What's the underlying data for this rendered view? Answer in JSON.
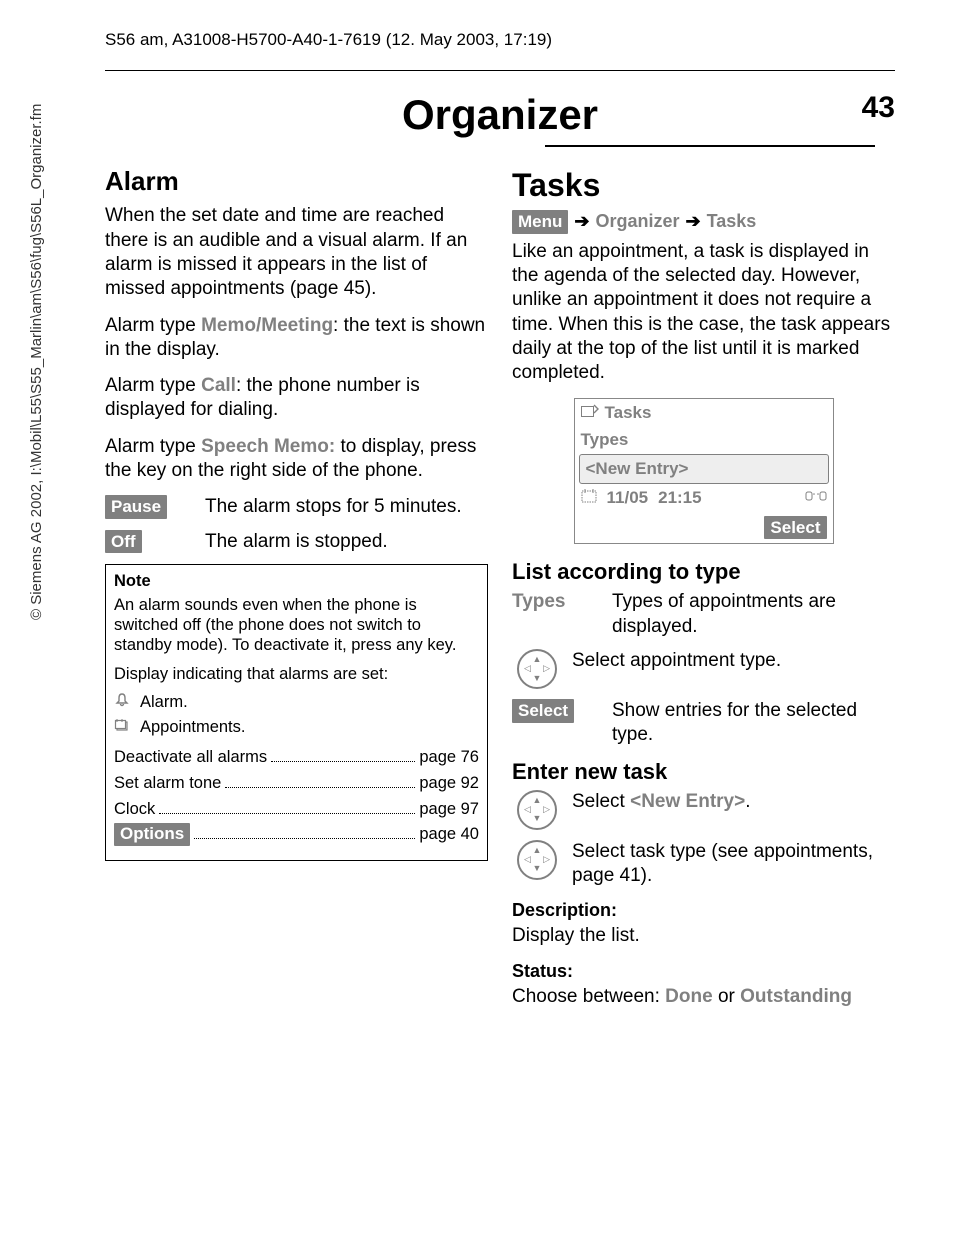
{
  "copyright": "© Siemens AG 2002, I:\\Mobil\\L55\\S55_Marlin\\am\\S56\\fug\\S56L_Organizer.fm",
  "doc_header": "S56 am, A31008-H5700-A40-1-7619 (12. May 2003, 17:19)",
  "chapter_title": "Organizer",
  "page_number": "43",
  "left": {
    "alarm_heading": "Alarm",
    "alarm_para1": "When the set date and time are reached there is an audible and a visual alarm. If an alarm is missed it appears in the list of missed appointments (page 45).",
    "alarm_type_memo_pre": "Alarm type ",
    "alarm_type_memo_label": "Memo/Meeting",
    "alarm_type_memo_post": ": the text is shown in the display.",
    "alarm_type_call_pre": "Alarm type ",
    "alarm_type_call_label": "Call",
    "alarm_type_call_post": ": the phone number is displayed for dialing.",
    "alarm_type_speech_pre": "Alarm type ",
    "alarm_type_speech_label": "Speech Memo:",
    "alarm_type_speech_post": " to display, press the key on the right side of the phone.",
    "pause_btn": "Pause",
    "pause_text": "The alarm stops for 5 minutes.",
    "off_btn": "Off",
    "off_text": "The alarm is stopped.",
    "note_title": "Note",
    "note_p1": "An alarm sounds even when the phone is switched off (the phone does not switch to standby mode). To deactivate it, press any key.",
    "note_p2": "Display indicating that alarms are set:",
    "note_alarm_label": "Alarm.",
    "note_appts_label": "Appointments.",
    "refs": [
      {
        "label": "Deactivate all alarms",
        "page": "page 76"
      },
      {
        "label": "Set alarm tone",
        "page": "page 92"
      },
      {
        "label": "Clock",
        "page": "page 97"
      }
    ],
    "options_btn": "Options",
    "options_page": "page 40"
  },
  "right": {
    "tasks_heading": "Tasks",
    "nav_menu": "Menu",
    "nav_org": "Organizer",
    "nav_tasks": "Tasks",
    "tasks_para": "Like an appointment, a task is displayed in the agenda of the selected day. However, unlike an appointment it does not require a time. When this is the case, the task appears daily at the top of the list until it is marked completed.",
    "screen": {
      "title": "Tasks",
      "types": "Types",
      "new_entry": "<New Entry>",
      "date": "11/05",
      "time": "21:15",
      "select": "Select"
    },
    "list_heading": "List according to type",
    "types_label": "Types",
    "types_text": "Types of appointments are displayed.",
    "nav_select_text": "Select appointment type.",
    "select_btn": "Select",
    "select_text": "Show entries for the selected type.",
    "enter_heading": "Enter new task",
    "new_entry_pre": "Select ",
    "new_entry_label": "<New Entry>",
    "new_entry_post": ".",
    "select_type_text": "Select task type (see appointments, page 41).",
    "desc_heading": "Description:",
    "desc_text": "Display the list.",
    "status_heading": "Status:",
    "status_pre": "Choose between: ",
    "status_done": "Done",
    "status_or": " or ",
    "status_out": "Outstanding"
  }
}
